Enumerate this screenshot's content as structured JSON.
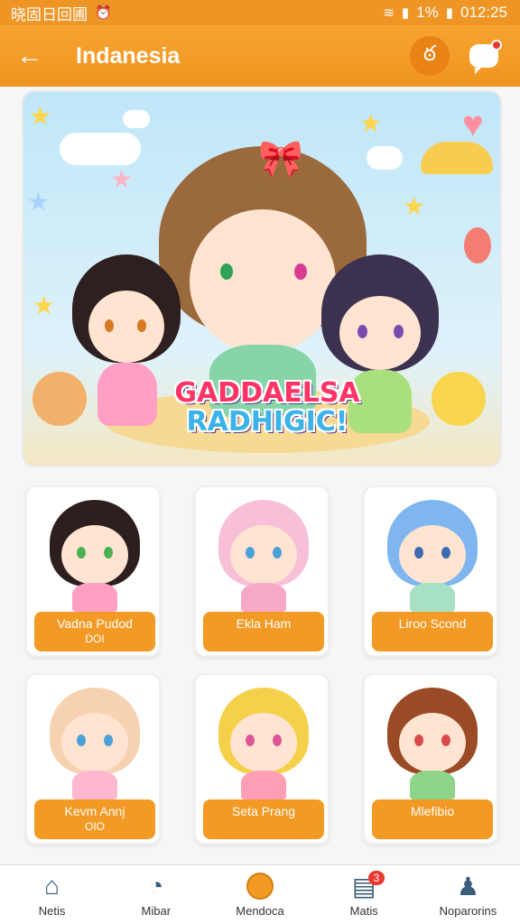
{
  "status_bar": {
    "left_text": "晓固日回圃",
    "icons": [
      "alarm-icon",
      "wifi-icon",
      "signal-icon"
    ],
    "battery": "1%",
    "time": "012:25"
  },
  "app_bar": {
    "title": "Indanesia",
    "back_icon": "arrow-left-icon",
    "action_icon": "swirl-icon",
    "chat_icon": "chat-bubble-icon"
  },
  "hero": {
    "title_line1": "GADDAELSA",
    "title_line2": "RADHIGIC!"
  },
  "cards": [
    {
      "name": "Vadna Pudod",
      "sub": "DOI",
      "hair": "#2e1f1f",
      "outfit": "#ff9fc4",
      "eye": "#4caf50"
    },
    {
      "name": "Ekla Ham",
      "sub": "",
      "hair": "#f7c0d8",
      "outfit": "#f7a7c8",
      "eye": "#4aa0d8"
    },
    {
      "name": "Liroo Scond",
      "sub": "",
      "hair": "#7fb6ef",
      "outfit": "#a8e0c4",
      "eye": "#3d6ab0"
    },
    {
      "name": "Kevm Annj",
      "sub": "OIO",
      "hair": "#f6d2b0",
      "outfit": "#ffb6d0",
      "eye": "#4aa0d8"
    },
    {
      "name": "Seta Prang",
      "sub": "",
      "hair": "#f5d04a",
      "outfit": "#ff9fb5",
      "eye": "#e0559a"
    },
    {
      "name": "Mlefibio",
      "sub": "",
      "hair": "#9a4a24",
      "outfit": "#8ed48a",
      "eye": "#d94a4a"
    }
  ],
  "bottom_nav": [
    {
      "label": "Netis",
      "icon": "home-icon"
    },
    {
      "label": "Mibar",
      "icon": "compass-icon"
    },
    {
      "label": "Mendoca",
      "icon": "circle-icon"
    },
    {
      "label": "Matis",
      "icon": "inbox-icon",
      "badge": "3"
    },
    {
      "label": "Noparorins",
      "icon": "profile-icon"
    }
  ],
  "colors": {
    "primary": "#f39a24",
    "accent_dark": "#e98316",
    "badge": "#e8392f"
  }
}
